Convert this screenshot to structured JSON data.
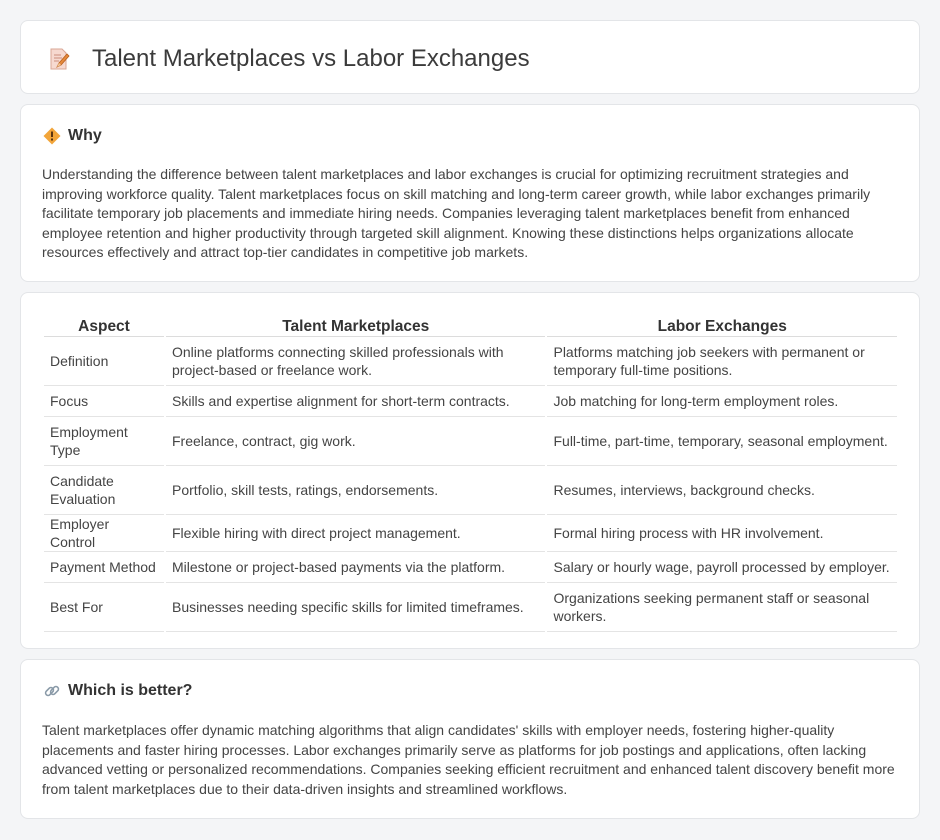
{
  "header": {
    "title": "Talent Marketplaces vs Labor Exchanges",
    "icon": "document-pencil-icon"
  },
  "why": {
    "title": "Why",
    "icon": "diamond-warning-icon",
    "text": "Understanding the difference between talent marketplaces and labor exchanges is crucial for optimizing recruitment strategies and improving workforce quality. Talent marketplaces focus on skill matching and long-term career growth, while labor exchanges primarily facilitate temporary job placements and immediate hiring needs. Companies leveraging talent marketplaces benefit from enhanced employee retention and higher productivity through targeted skill alignment. Knowing these distinctions helps organizations allocate resources effectively and attract top-tier candidates in competitive job markets."
  },
  "table": {
    "headers": [
      "Aspect",
      "Talent Marketplaces",
      "Labor Exchanges"
    ],
    "rows": [
      [
        "Definition",
        "Online platforms connecting skilled professionals with project-based or freelance work.",
        "Platforms matching job seekers with permanent or temporary full-time positions."
      ],
      [
        "Focus",
        "Skills and expertise alignment for short-term contracts.",
        "Job matching for long-term employment roles."
      ],
      [
        "Employment Type",
        "Freelance, contract, gig work.",
        "Full-time, part-time, temporary, seasonal employment."
      ],
      [
        "Candidate Evaluation",
        "Portfolio, skill tests, ratings, endorsements.",
        "Resumes, interviews, background checks."
      ],
      [
        "Employer Control",
        "Flexible hiring with direct project management.",
        "Formal hiring process with HR involvement."
      ],
      [
        "Payment Method",
        "Milestone or project-based payments via the platform.",
        "Salary or hourly wage, payroll processed by employer."
      ],
      [
        "Best For",
        "Businesses needing specific skills for limited timeframes.",
        "Organizations seeking permanent staff or seasonal workers."
      ]
    ]
  },
  "better": {
    "title": "Which is better?",
    "icon": "link-icon",
    "text": "Talent marketplaces offer dynamic matching algorithms that align candidates' skills with employer needs, fostering higher-quality placements and faster hiring processes. Labor exchanges primarily serve as platforms for job postings and applications, often lacking advanced vetting or personalized recommendations. Companies seeking efficient recruitment and enhanced talent discovery benefit more from talent marketplaces due to their data-driven insights and streamlined workflows."
  }
}
